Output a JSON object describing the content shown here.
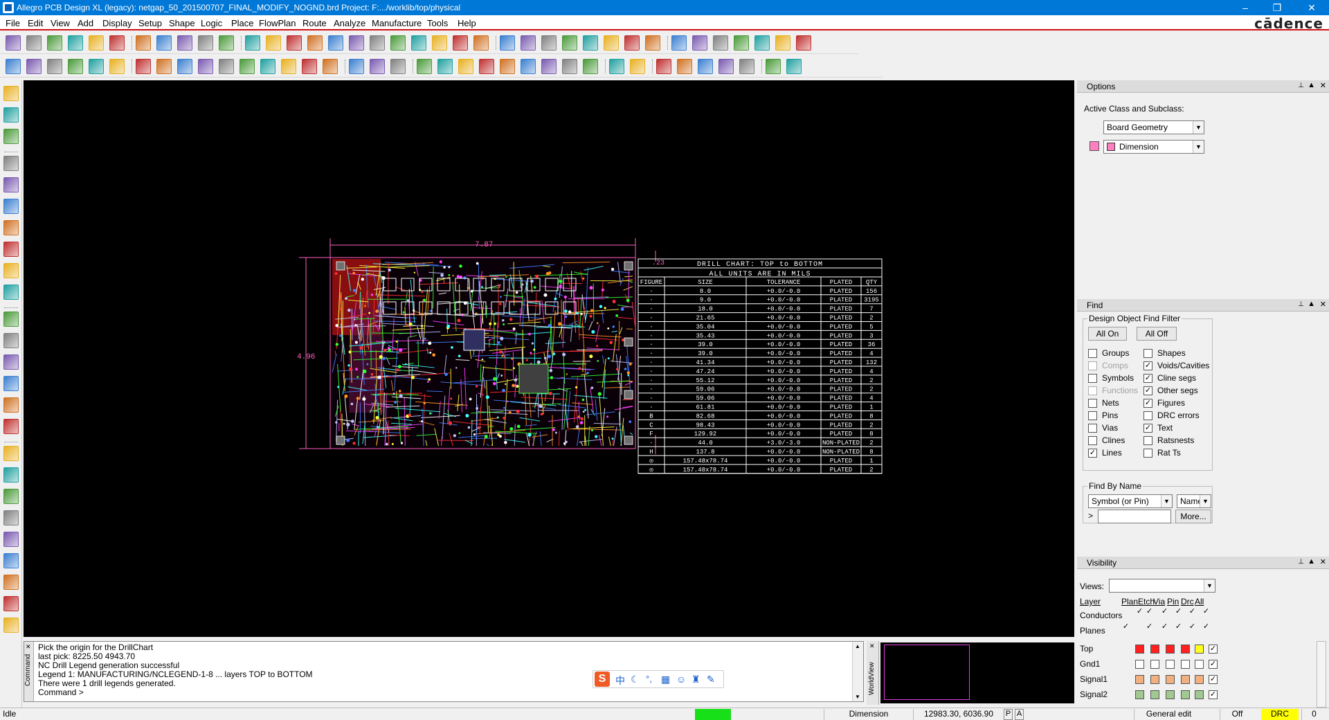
{
  "titlebar": {
    "title": "Allegro PCB Design XL (legacy): netgap_50_201500707_FINAL_MODIFY_NOGND.brd  Project: F:.../worklib/top/physical",
    "minimize": "–",
    "restore": "❐",
    "close": "✕"
  },
  "menubar": {
    "items": [
      "File",
      "Edit",
      "View",
      "Add",
      "Display",
      "Setup",
      "Shape",
      "Logic",
      "Place",
      "FlowPlan",
      "Route",
      "Analyze",
      "Manufacture",
      "Tools",
      "Help"
    ],
    "logo": "cādence"
  },
  "canvas": {
    "dim_horizontal": "7.87",
    "dim_vertical": "4.96",
    "dim_small": ".23",
    "drill_chart": {
      "title1": "DRILL CHART: TOP to BOTTOM",
      "title2": "ALL UNITS ARE IN MILS",
      "headers": [
        "FIGURE",
        "SIZE",
        "TOLERANCE",
        "PLATED",
        "QTY"
      ],
      "rows": [
        [
          "·",
          "8.0",
          "+0.0/-0.0",
          "PLATED",
          "156"
        ],
        [
          "·",
          "9.0",
          "+0.0/-0.0",
          "PLATED",
          "3195"
        ],
        [
          "·",
          "18.0",
          "+0.0/-0.0",
          "PLATED",
          "7"
        ],
        [
          "·",
          "21.65",
          "+0.0/-0.0",
          "PLATED",
          "2"
        ],
        [
          "·",
          "35.04",
          "+0.0/-0.0",
          "PLATED",
          "5"
        ],
        [
          "·",
          "35.43",
          "+0.0/-0.0",
          "PLATED",
          "3"
        ],
        [
          "·",
          "39.0",
          "+0.0/-0.0",
          "PLATED",
          "36"
        ],
        [
          "·",
          "39.0",
          "+0.0/-0.0",
          "PLATED",
          "4"
        ],
        [
          "·",
          "41.34",
          "+0.0/-0.0",
          "PLATED",
          "132"
        ],
        [
          "·",
          "47.24",
          "+0.0/-0.0",
          "PLATED",
          "4"
        ],
        [
          "·",
          "55.12",
          "+0.0/-0.0",
          "PLATED",
          "2"
        ],
        [
          "·",
          "59.06",
          "+0.0/-0.0",
          "PLATED",
          "2"
        ],
        [
          "·",
          "59.06",
          "+0.0/-0.0",
          "PLATED",
          "4"
        ],
        [
          "·",
          "61.81",
          "+0.0/-0.0",
          "PLATED",
          "1"
        ],
        [
          "B",
          "82.68",
          "+0.0/-0.0",
          "PLATED",
          "8"
        ],
        [
          "C",
          "98.43",
          "+0.0/-0.0",
          "PLATED",
          "2"
        ],
        [
          "F",
          "129.92",
          "+0.0/-0.0",
          "PLATED",
          "8"
        ],
        [
          "·",
          "44.0",
          "+3.0/-3.0",
          "NON-PLATED",
          "2"
        ],
        [
          "H",
          "137.8",
          "+0.0/-0.0",
          "NON-PLATED",
          "8"
        ],
        [
          "◎",
          "157.48x78.74",
          "+0.0/-0.0",
          "PLATED",
          "1"
        ],
        [
          "◎",
          "157.48x78.74",
          "+0.0/-0.0",
          "PLATED",
          "2"
        ]
      ]
    }
  },
  "options": {
    "title": "Options",
    "active_label": "Active Class and Subclass:",
    "class_value": "Board Geometry",
    "subclass_value": "Dimension",
    "subclass_color": "#ff80c0"
  },
  "find": {
    "title": "Find",
    "group_label": "Design Object Find Filter",
    "all_on": "All On",
    "all_off": "All Off",
    "left_items": [
      {
        "label": "Groups",
        "checked": false,
        "disabled": false
      },
      {
        "label": "Comps",
        "checked": false,
        "disabled": true
      },
      {
        "label": "Symbols",
        "checked": false,
        "disabled": false
      },
      {
        "label": "Functions",
        "checked": false,
        "disabled": true
      },
      {
        "label": "Nets",
        "checked": false,
        "disabled": false
      },
      {
        "label": "Pins",
        "checked": false,
        "disabled": false
      },
      {
        "label": "Vias",
        "checked": false,
        "disabled": false
      },
      {
        "label": "Clines",
        "checked": false,
        "disabled": false
      },
      {
        "label": "Lines",
        "checked": true,
        "disabled": false
      }
    ],
    "right_items": [
      {
        "label": "Shapes",
        "checked": false,
        "disabled": false
      },
      {
        "label": "Voids/Cavities",
        "checked": true,
        "disabled": false
      },
      {
        "label": "Cline segs",
        "checked": true,
        "disabled": false
      },
      {
        "label": "Other segs",
        "checked": true,
        "disabled": false
      },
      {
        "label": "Figures",
        "checked": true,
        "disabled": false
      },
      {
        "label": "DRC errors",
        "checked": false,
        "disabled": false
      },
      {
        "label": "Text",
        "checked": true,
        "disabled": false
      },
      {
        "label": "Ratsnests",
        "checked": false,
        "disabled": false
      },
      {
        "label": "Rat Ts",
        "checked": false,
        "disabled": false
      }
    ],
    "by_name_label": "Find By Name",
    "by_name_type": "Symbol (or Pin)",
    "by_name_mode": "Name",
    "name_prefix": ">",
    "more": "More..."
  },
  "visibility": {
    "title": "Visibility",
    "views_label": "Views:",
    "views_value": "",
    "headers": [
      "Layer",
      "Plan",
      "Etch",
      "Via",
      "Pin",
      "Drc",
      "All"
    ],
    "groups": [
      {
        "name": "Conductors",
        "checks": [
          true,
          true,
          true,
          true,
          true,
          true
        ]
      },
      {
        "name": "Planes",
        "checks": [
          true,
          true,
          true,
          true,
          true,
          true
        ]
      }
    ],
    "layers": [
      {
        "name": "Top",
        "colors": [
          "#ff2020",
          "#ff2020",
          "#ff2020",
          "#ff2020",
          "#ffff20"
        ],
        "all": true
      },
      {
        "name": "Gnd1",
        "colors": [
          "#ffffff",
          "#ffffff",
          "#ffffff",
          "#ffffff",
          "#ffffff"
        ],
        "all": true
      },
      {
        "name": "Signal1",
        "colors": [
          "#f0b080",
          "#f0b080",
          "#f0b080",
          "#f0b080",
          "#f0b080"
        ],
        "all": true
      },
      {
        "name": "Signal2",
        "colors": [
          "#a0c890",
          "#a0c890",
          "#a0c890",
          "#a0c890",
          "#a0c890"
        ],
        "all": true
      }
    ]
  },
  "command": {
    "tab_label": "Command",
    "lines": [
      "Pick the origin for the DrillChart",
      "last pick:  8225.50  4943.70",
      "NC Drill Legend generation successful",
      "Legend 1: MANUFACTURING/NCLEGEND-1-8 ... layers TOP to BOTTOM",
      "There were 1 drill legends generated.",
      "Command >"
    ]
  },
  "worldview": {
    "tab_label": "WorldView"
  },
  "ime": {
    "brand": "S",
    "chars": [
      "中",
      "ノ",
      "°,",
      "⌨",
      "☃",
      "👕",
      "🔧"
    ]
  },
  "status": {
    "state": "Idle",
    "status_color": "#18e018",
    "subclass": "Dimension",
    "coords": "12983.30, 6036.90",
    "p_label": "P",
    "a_label": "A",
    "mode": "General edit",
    "off": "Off",
    "drc": "DRC",
    "drc_color": "#ffff00",
    "count": "0"
  }
}
